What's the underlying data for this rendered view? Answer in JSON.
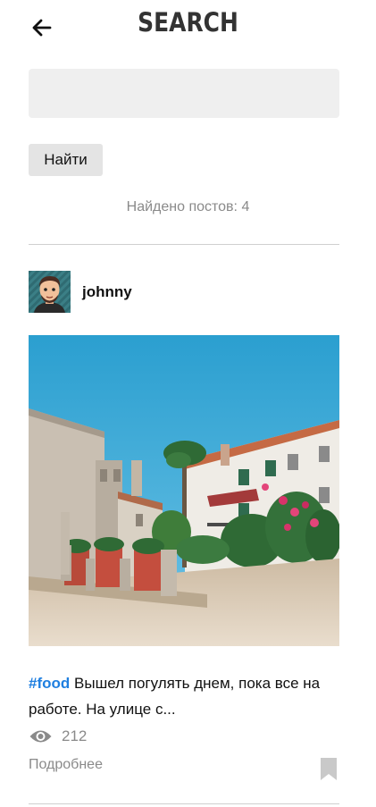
{
  "header": {
    "title": "SEARCH",
    "back_icon": "arrow-left-icon"
  },
  "search": {
    "value": "",
    "placeholder": "",
    "button_label": "Найти",
    "found_text": "Найдено постов: 4"
  },
  "posts": [
    {
      "author": "johnny",
      "avatar_icon": "user-avatar",
      "hashtag": "#food",
      "text": "Вышел погулять днем, пока все на работе. На улице с...",
      "views": "212",
      "view_icon": "eye-icon",
      "more_label": "Подробнее",
      "bookmark_icon": "bookmark-icon"
    }
  ],
  "colors": {
    "accent": "#1f7fe0",
    "muted_text": "#8a8a8a",
    "input_bg": "#efefef",
    "button_bg": "#e4e4e4"
  }
}
